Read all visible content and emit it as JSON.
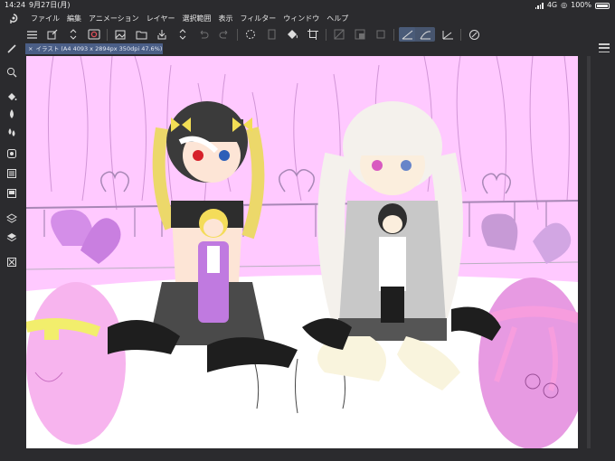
{
  "status_bar": {
    "time": "14:24",
    "date": "9月27日(月)",
    "network": "4G",
    "battery": "100%"
  },
  "menu": {
    "items": [
      "ファイル",
      "編集",
      "アニメーション",
      "レイヤー",
      "選択範囲",
      "表示",
      "フィルター",
      "ウィンドウ",
      "ヘルプ"
    ]
  },
  "toolbar": {
    "icons": [
      "menu-icon",
      "new-canvas-icon",
      "open-icon",
      "save-icon",
      "undo-icon",
      "redo-icon",
      "transform-icon",
      "fill-icon",
      "selection-icon",
      "ruler-icon"
    ]
  },
  "tools": {
    "icons": [
      "brush-icon",
      "zoom-icon",
      "fill-icon",
      "ink-icon",
      "color-mix-icon",
      "layers-icon",
      "properties-icon",
      "navigator-icon",
      "material-icon"
    ]
  },
  "document": {
    "tab_label": "イラスト (A4 4093 x 2894px 350dpi 47.6%)",
    "close": "×"
  },
  "colors": {
    "background": "#2b2b2e",
    "canvas_bg": "#ffc8ff",
    "tab": "#4a5e86",
    "accent": "#4a5b78"
  }
}
